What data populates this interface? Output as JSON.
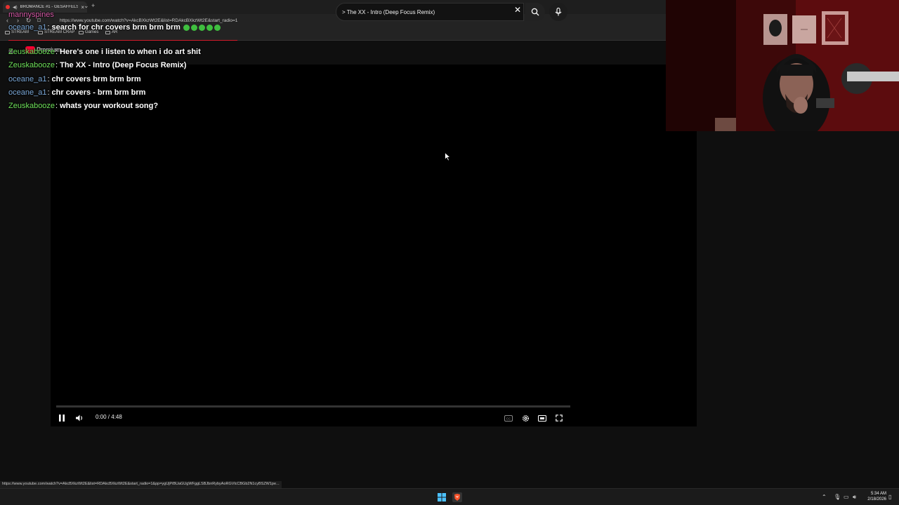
{
  "browser": {
    "tab_title": "BROMANCE #1 - GESAFFELSTEIN",
    "url": "https://www.youtube.com/watch?v=AkcBXkzWt2E&list=RDAkcBXkzWt2E&start_radio=1",
    "bookmarks": [
      "STREAM",
      "STREAM CRAP",
      "Games",
      "AR"
    ],
    "status_url": "https://www.youtube.com/watch?v=AkcBXkzWt2E&list=RDAkcBXkzWt2E&start_radio=1&pp=ygUjPiBUaGUgWFggLSBJbnRybyAoRGVlcCBGb2N1cyBSZW1pe..."
  },
  "youtube": {
    "premium_label": "Premium",
    "search_value": "> The XX - Intro (Deep Focus Remix)",
    "player": {
      "time": "0:00 / 4:48",
      "progress_fraction": 0
    }
  },
  "chat": {
    "top_user": "mannyspines",
    "messages": [
      {
        "user": "oceane_a1",
        "text": "search for chr covers brm brm brm",
        "user_color": "#7aa7d6"
      },
      {
        "user": "Zeuskabooze",
        "text": "Here's one i listen to when i do art shit",
        "user_color": "#6ee05a"
      },
      {
        "user": "Zeuskabooze",
        "text": "The XX - Intro (Deep Focus Remix)",
        "user_color": "#6ee05a"
      },
      {
        "user": "oceane_a1",
        "text": "chr covers brm brm brm",
        "user_color": "#7aa7d6"
      },
      {
        "user": "oceane_a1",
        "text": "chr covers - brm brm brm",
        "user_color": "#7aa7d6"
      },
      {
        "user": "Zeuskabooze",
        "text": "whats your workout song?",
        "user_color": "#6ee05a"
      }
    ]
  },
  "taskbar": {
    "time": "5:34 AM",
    "date": "2/18/2026"
  }
}
